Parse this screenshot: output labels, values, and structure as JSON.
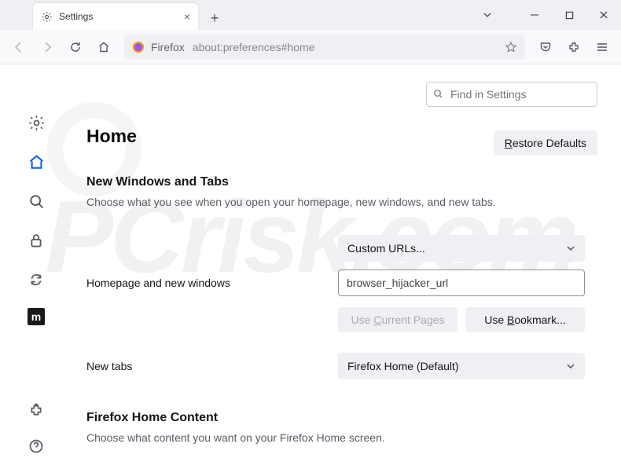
{
  "tab": {
    "title": "Settings"
  },
  "urlbar": {
    "identity": "Firefox",
    "url": "about:preferences#home"
  },
  "search": {
    "placeholder": "Find in Settings"
  },
  "page": {
    "title": "Home",
    "restore_btn": "Restore Defaults"
  },
  "section1": {
    "heading": "New Windows and Tabs",
    "desc": "Choose what you see when you open your homepage, new windows, and new tabs."
  },
  "homepage": {
    "label": "Homepage and new windows",
    "select": "Custom URLs...",
    "url_value": "browser_hijacker_url",
    "use_current": "Use Current Pages",
    "use_bookmark": "Use Bookmark..."
  },
  "newtabs": {
    "label": "New tabs",
    "select": "Firefox Home (Default)"
  },
  "section2": {
    "heading": "Firefox Home Content",
    "desc": "Choose what content you want on your Firefox Home screen."
  }
}
